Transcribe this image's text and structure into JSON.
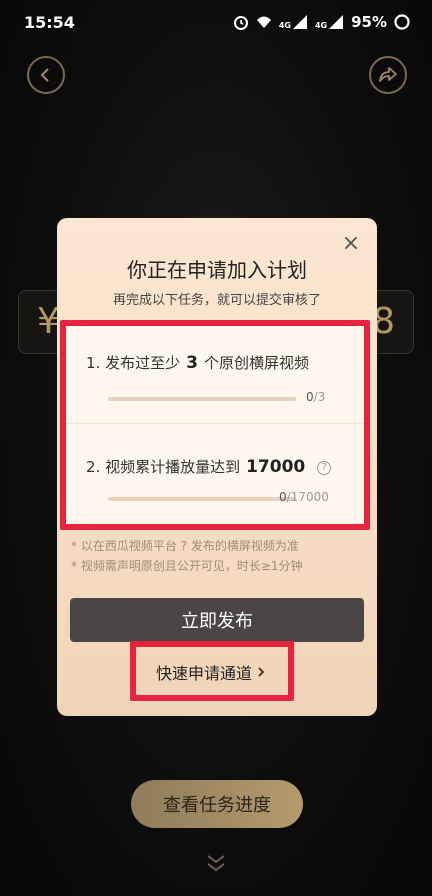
{
  "status_bar": {
    "time": "15:54",
    "signal_1": "4G",
    "signal_2": "4G",
    "battery": "95%"
  },
  "background": {
    "left_digit": "¥",
    "right_digit": "8",
    "progress_button_label": "查看任务进度"
  },
  "dialog": {
    "title": "你正在申请加入计划",
    "subtitle": "再完成以下任务，就可以提交审核了",
    "tasks": [
      {
        "prefix": "1. 发布过至少",
        "number": "3",
        "suffix": "个原创横屏视频",
        "current": "0",
        "target": "/3",
        "progress": 0
      },
      {
        "prefix": "2. 视频累计播放量达到",
        "number": "17000",
        "suffix": "",
        "current": "0",
        "target": "/17000",
        "progress": 0
      }
    ],
    "notes": [
      "* 以在西瓜视频平台 ? 发布的横屏视频为准",
      "* 视频需声明原创且公开可见，时长≥1分钟"
    ],
    "publish_button": "立即发布",
    "fast_apply_link": "快速申请通道",
    "close_icon": "close-icon"
  },
  "colors": {
    "highlight": "#e8233d",
    "accent_gold": "#b4985f",
    "dialog_bg": "#fbe7d2",
    "publish_btn": "#4a4645"
  }
}
